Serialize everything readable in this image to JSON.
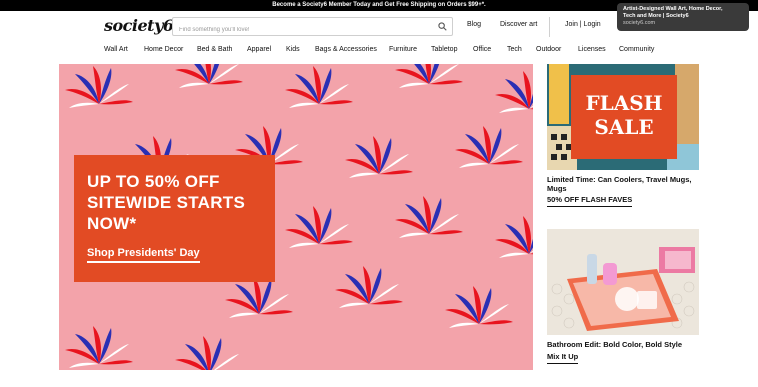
{
  "promo_bar": {
    "text": "Become a Society6 Member Today and Get Free Shipping on Orders $99+*."
  },
  "header": {
    "logo": "society6",
    "search_placeholder": "Find something you'll love!",
    "blog": "Blog",
    "discover": "Discover art",
    "join_login": "Join | Login"
  },
  "nav": {
    "items": [
      "Wall Art",
      "Home Decor",
      "Bed & Bath",
      "Apparel",
      "Kids",
      "Bags & Accessories",
      "Furniture",
      "Tabletop",
      "Office",
      "Tech",
      "Outdoor",
      "Licenses",
      "Community"
    ]
  },
  "hero": {
    "title": "UP TO 50% OFF\nSITEWIDE STARTS\nNOW*",
    "cta": "Shop Presidents' Day"
  },
  "card1": {
    "image_text": "FLASH\nSALE",
    "title": "Limited Time: Can Coolers, Travel Mugs,\nMugs",
    "link": "50% OFF FLASH FAVES"
  },
  "card2": {
    "title": "Bathroom Edit: Bold Color, Bold Style",
    "link": "Mix It Up"
  },
  "tooltip": {
    "title": "Artist-Designed Wall Art, Home Decor,\nTech and More | Society6",
    "url": "society6.com"
  },
  "colors": {
    "hero_bg": "#f3a3aa",
    "accent_orange": "#e24b24",
    "firework_red": "#e8141e",
    "firework_blue": "#2a2fb4"
  }
}
